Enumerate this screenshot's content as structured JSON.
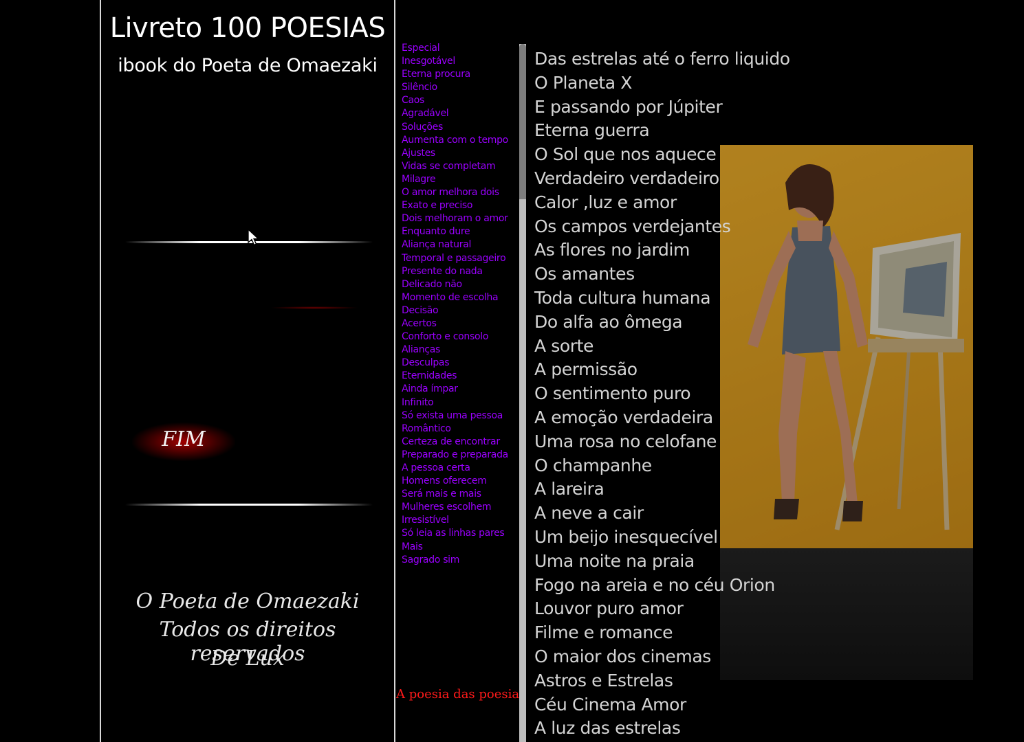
{
  "header": {
    "title": "Livreto 100 POESIAS",
    "subtitle": "ibook do Poeta de Omaezaki"
  },
  "left": {
    "fim": "FIM",
    "footer": [
      "O Poeta de Omaezaki",
      "Todos os direitos reservados",
      "De  Lux"
    ]
  },
  "links": [
    "Especial",
    "Inesgotável",
    "Eterna procura",
    "Silêncio",
    "Caos",
    "Agradável",
    "Soluções",
    "Aumenta com o tempo",
    "Ajustes",
    "Vidas se completam",
    "Milagre",
    "O amor melhora dois",
    "Exato e preciso",
    "Dois melhoram o amor",
    "Enquanto dure",
    "Aliança natural",
    "Temporal e passageiro",
    "Presente do nada",
    "Delicado não",
    "Momento de escolha",
    "Decisão",
    "Acertos",
    "Conforto e consolo",
    "Alianças",
    "Desculpas",
    "Eternidades",
    "Ainda ímpar",
    "Infinito",
    "Só exista uma pessoa",
    "Romântico",
    "Certeza de encontrar",
    "Preparado e preparada",
    "A pessoa certa",
    "Homens oferecem",
    "Será mais e mais",
    "Mulheres escolhem",
    "Irresistível",
    "Só leia as linhas pares",
    "Mais",
    "Sagrado sim"
  ],
  "featured_link": "A poesia das poesias",
  "poem": [
    "Das estrelas até o ferro liquido",
    "O Planeta X",
    "E passando por Júpiter",
    "Eterna guerra",
    "O Sol que nos aquece",
    "Verdadeiro  verdadeiro",
    "Calor ,luz e amor",
    "Os campos verdejantes",
    "As flores no jardim",
    "Os amantes",
    "Toda cultura humana",
    "Do alfa ao ômega",
    "A sorte",
    "A permissão",
    "O sentimento puro",
    "A emoção verdadeira",
    "Uma rosa no celofane",
    "O champanhe",
    "A lareira",
    "A neve a cair",
    "Um beijo inesquecível",
    "Uma noite na praia",
    "Fogo na areia e no céu Orion",
    "Louvor puro amor",
    "Filme e romance",
    "O maior dos cinemas",
    "Astros e Estrelas",
    "Céu Cinema Amor",
    "A luz das estrelas"
  ],
  "colors": {
    "background": "#000000",
    "link": "#9b00ff",
    "featured_link": "#ff1a1a",
    "poem_text": "#d4d4d4",
    "photo_backdrop": "#e0a326"
  },
  "icons": {
    "cursor": "mouse-pointer-icon"
  }
}
